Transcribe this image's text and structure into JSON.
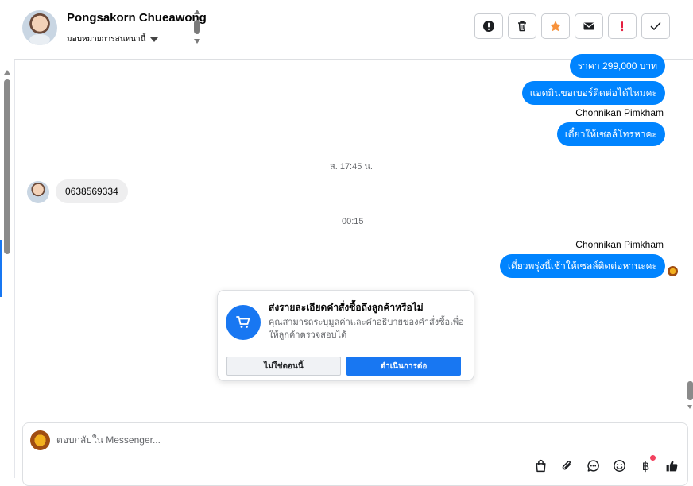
{
  "header": {
    "contact_name": "Pongsakorn Chueawong",
    "assign_label": "มอบหมายการสนทนานี้",
    "actions": [
      {
        "name": "report-icon",
        "color": "#1c1e21"
      },
      {
        "name": "trash-icon",
        "color": "#1c1e21"
      },
      {
        "name": "star-icon",
        "color": "#f7923b"
      },
      {
        "name": "envelope-icon",
        "color": "#1c1e21"
      },
      {
        "name": "exclamation-icon",
        "color": "#e41e3f"
      },
      {
        "name": "check-icon",
        "color": "#1c1e21"
      }
    ]
  },
  "messages": {
    "m1": "ราคา 299,000 บาท",
    "m2": "แอดมินขอเบอร์ติดต่อได้ไหมคะ",
    "sender1": "Chonnikan Pimkham",
    "m3": "เดี๋ยวให้เซลล์โทรหาคะ",
    "time1": "ส. 17:45 น.",
    "m4": "0638569334",
    "time2": "00:15",
    "sender2": "Chonnikan Pimkham",
    "m5": "เดี๋ยวพรุ่งนี้เช้าให้เซลล์ติดต่อหานะคะ"
  },
  "order_card": {
    "title": "ส่งรายละเอียดคำสั่งซื้อถึงลูกค้าหรือไม่",
    "description": "คุณสามารถระบุมูลค่าและคำอธิบายของคำสั่งซื้อเพื่อให้ลูกค้าตรวจสอบได้",
    "decline_label": "ไม่ใช่ตอนนี้",
    "continue_label": "ดำเนินการต่อ",
    "icon": "cart-icon"
  },
  "composer": {
    "placeholder": "ตอบกลับใน Messenger...",
    "tools": [
      "bag-icon",
      "paperclip-icon",
      "chat-bubble-icon",
      "emoji-icon",
      "baht-icon",
      "thumbs-up-icon"
    ],
    "baht_symbol": "฿"
  },
  "colors": {
    "accent": "#0084ff",
    "button_blue": "#1877f2",
    "star": "#f7923b",
    "alert": "#e41e3f",
    "notification_dot": "#f3425f"
  }
}
